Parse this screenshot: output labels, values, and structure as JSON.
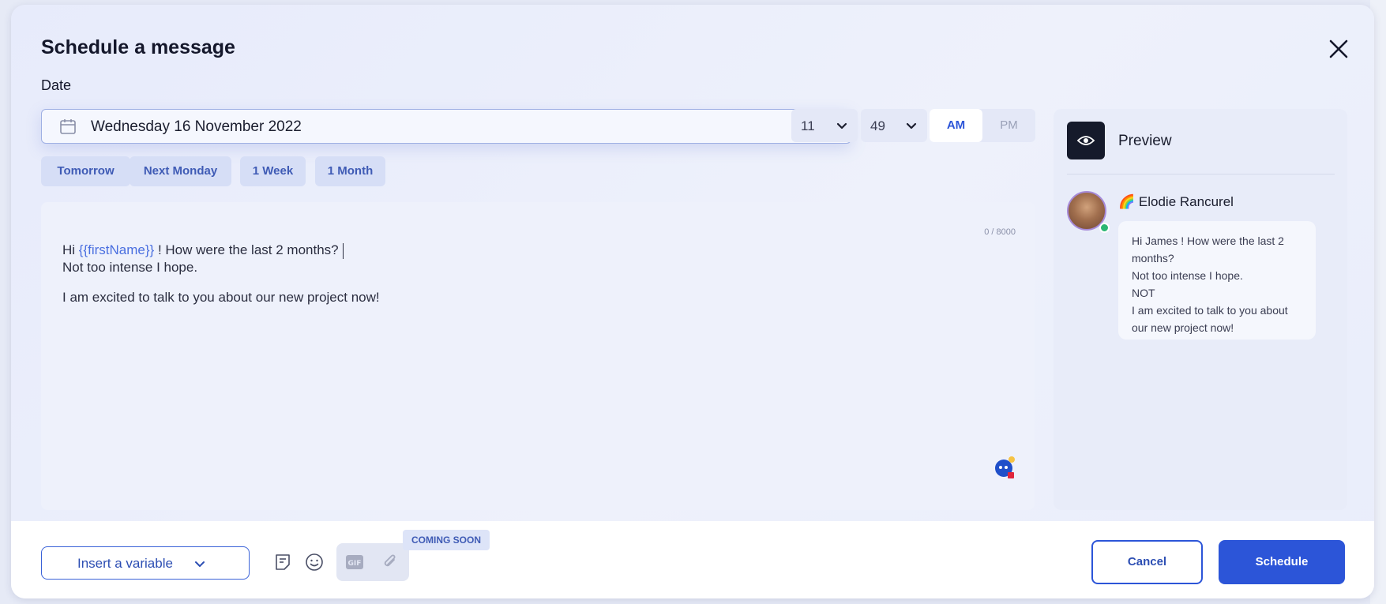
{
  "modal": {
    "title": "Schedule a message",
    "date_label": "Date"
  },
  "date": {
    "value": "Wednesday 16 November 2022",
    "hour": "11",
    "minute": "49",
    "am_label": "AM",
    "pm_label": "PM",
    "selected_period": "AM"
  },
  "quick_options": [
    "Tomorrow",
    "Next Monday",
    "1 Week",
    "1 Month"
  ],
  "editor": {
    "counter": "0 / 8000",
    "line1_before": "Hi ",
    "line1_variable": "{{firstName}}",
    "line1_after": " ! How were the last 2 months?",
    "line2": "Not too intense I hope.",
    "line3": "I am excited to talk to you about our new project now!"
  },
  "preview": {
    "title": "Preview",
    "sender_emoji": "🌈",
    "sender_name": "Elodie Rancurel",
    "message": "Hi James ! How were the last 2\nmonths?\nNot too intense I hope.\nNOT\nI am excited to talk to you about\nour new project now!"
  },
  "footer": {
    "insert_variable_label": "Insert a variable",
    "coming_soon_label": "COMING SOON",
    "gif_label": "GIF",
    "cancel_label": "Cancel",
    "schedule_label": "Schedule"
  },
  "colors": {
    "accent": "#2c55d8",
    "variable_text": "#4a6fe0",
    "online_status": "#2bb673"
  }
}
